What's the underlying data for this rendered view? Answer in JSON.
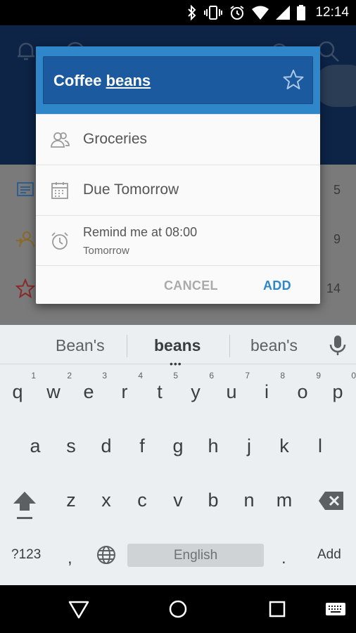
{
  "status_bar": {
    "time": "12:14"
  },
  "background_app": {
    "counts": [
      "5",
      "9",
      "14"
    ]
  },
  "dialog": {
    "input_value_plain": "Coffee ",
    "input_value_underlined": "beans",
    "list_label": "Groceries",
    "due_label": "Due Tomorrow",
    "reminder_label": "Remind me at 08:00",
    "reminder_sub": "Tomorrow",
    "cancel_label": "CANCEL",
    "add_label": "ADD",
    "accent_color": "#2f86c9"
  },
  "keyboard": {
    "suggestions": [
      "Bean's",
      "beans",
      "bean's"
    ],
    "row1": [
      {
        "key": "q",
        "hint": "1"
      },
      {
        "key": "w",
        "hint": "2"
      },
      {
        "key": "e",
        "hint": "3"
      },
      {
        "key": "r",
        "hint": "4"
      },
      {
        "key": "t",
        "hint": "5"
      },
      {
        "key": "y",
        "hint": "6"
      },
      {
        "key": "u",
        "hint": "7"
      },
      {
        "key": "i",
        "hint": "8"
      },
      {
        "key": "o",
        "hint": "9"
      },
      {
        "key": "p",
        "hint": "0"
      }
    ],
    "row2": [
      "a",
      "s",
      "d",
      "f",
      "g",
      "h",
      "j",
      "k",
      "l"
    ],
    "row3": [
      "z",
      "x",
      "c",
      "v",
      "b",
      "n",
      "m"
    ],
    "symbols_label": "?123",
    "comma_label": ",",
    "space_label": "English",
    "period_label": ".",
    "action_label": "Add"
  }
}
